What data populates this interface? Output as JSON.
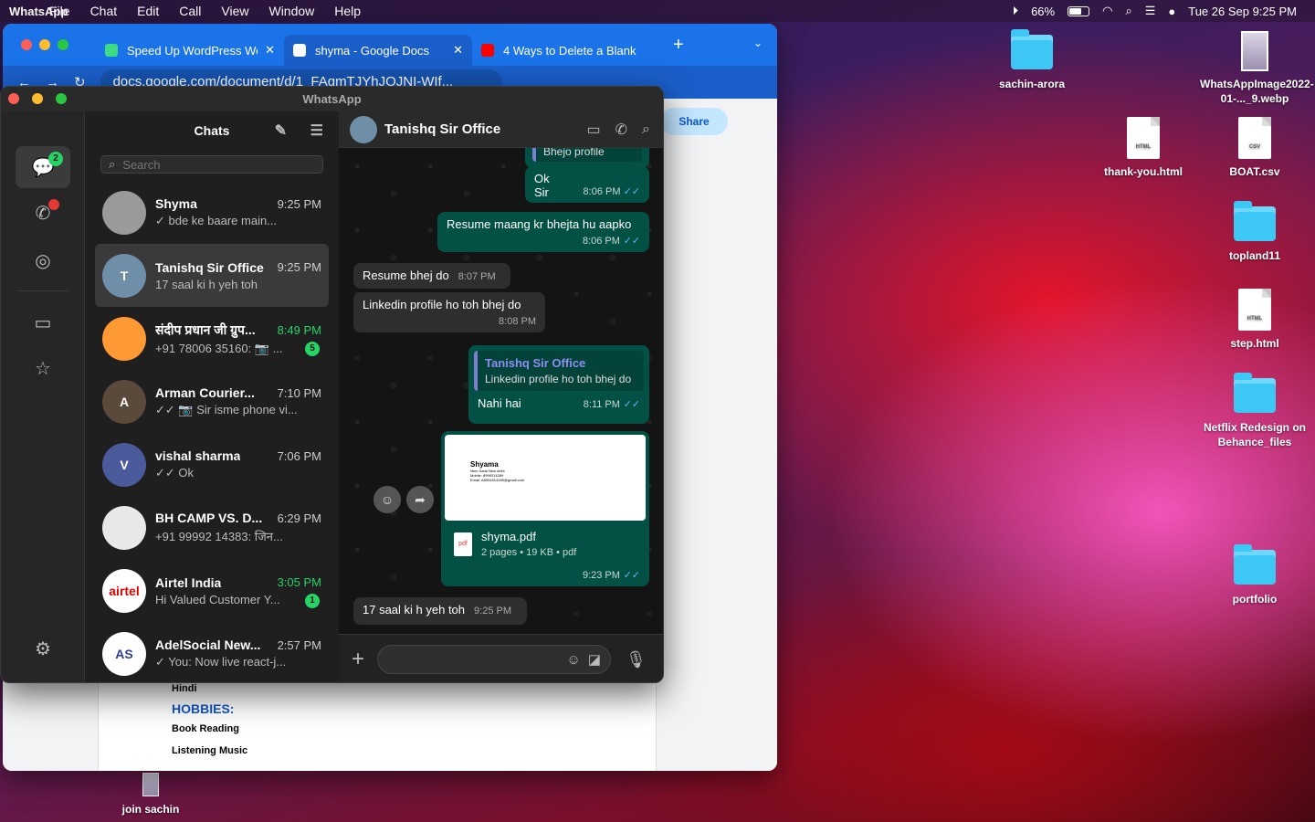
{
  "menubar": {
    "app": "WhatsApp",
    "items": [
      "File",
      "Chat",
      "Edit",
      "Call",
      "View",
      "Window",
      "Help"
    ],
    "battery": "66%",
    "battery_level": 0.66,
    "datetime": "Tue 26 Sep  9:25 PM"
  },
  "desktop": {
    "icons": [
      {
        "label": "sachin-arora",
        "type": "folder"
      },
      {
        "label": "WhatsAppImage2022-01-..._9.webp",
        "type": "image"
      },
      {
        "label": "thank-you.html",
        "type": "file",
        "badge": "HTML"
      },
      {
        "label": "BOAT.csv",
        "type": "file",
        "badge": "CSV"
      },
      {
        "label": "topland11",
        "type": "folder"
      },
      {
        "label": "step.html",
        "type": "file",
        "badge": "HTML"
      },
      {
        "label": "Netflix Redesign on Behance_files",
        "type": "folder"
      },
      {
        "label": "portfolio",
        "type": "folder"
      },
      {
        "label": "join sachin",
        "type": "image"
      }
    ]
  },
  "browser": {
    "tabs": [
      {
        "title": "Speed Up WordPress Web",
        "icon": "wordpress-icon"
      },
      {
        "title": "shyma - Google Docs",
        "icon": "docs-icon",
        "active": true
      },
      {
        "title": "4 Ways to Delete a Blank",
        "icon": "youtube-icon"
      }
    ],
    "url": "docs.google.com/document/d/1_FAqmTJYhJOJNI-WIf...",
    "share_label": "Share",
    "doc": {
      "line1": "Hindi",
      "heading": "HOBBIES:",
      "items": [
        "Book Reading",
        "Listening Music"
      ]
    }
  },
  "whatsapp": {
    "window_title": "WhatsApp",
    "rail": {
      "chats_badge": "2"
    },
    "list": {
      "title": "Chats",
      "search_placeholder": "Search",
      "chats": [
        {
          "name": "Shyma",
          "time": "9:25 PM",
          "preview": "✓ bde  ke baare main...",
          "avatar_color": "#9a9a9a",
          "initial": "",
          "unread": ""
        },
        {
          "name": "Tanishq Sir Office",
          "time": "9:25 PM",
          "preview": "17 saal ki h yeh toh",
          "avatar_color": "#6f8fa8",
          "initial": "T",
          "unread": "",
          "selected": true
        },
        {
          "name": "संदीप प्रधान जी ग्रुप...",
          "time": "8:49 PM",
          "preview": "+91 78006 35160: 📷 ...",
          "avatar_color": "#ff9933",
          "initial": "",
          "unread": "5",
          "time_green": true
        },
        {
          "name": "Arman Courier...",
          "time": "7:10 PM",
          "preview": "✓✓ 📷 Sir isme phone vi...",
          "avatar_color": "#5a4a3a",
          "initial": "A",
          "unread": ""
        },
        {
          "name": "vishal sharma",
          "time": "7:06 PM",
          "preview": "✓✓ Ok",
          "avatar_color": "#4b5a9a",
          "initial": "V",
          "unread": ""
        },
        {
          "name": "BH CAMP VS. D...",
          "time": "6:29 PM",
          "preview": "+91 99992 14383: जिन...",
          "avatar_color": "#e8e8e8",
          "initial": "",
          "unread": ""
        },
        {
          "name": "Airtel India",
          "time": "3:05 PM",
          "preview": "Hi  Valued Customer  Y...",
          "avatar_color": "#ffffff",
          "initial": "airtel",
          "unread": "1",
          "time_green": true
        },
        {
          "name": "AdelSocial New...",
          "time": "2:57 PM",
          "preview": "✓ You: Now live react-j...",
          "avatar_color": "#ffffff",
          "initial": "AS",
          "unread": ""
        }
      ]
    },
    "conversation": {
      "name": "Tanishq Sir Office",
      "messages": {
        "m0": {
          "text": "Bhejo profile"
        },
        "m1": {
          "text": "Ok\nSir",
          "time": "8:06 PM"
        },
        "m2": {
          "text": "Resume maang kr bhejta hu aapko",
          "time": "8:06 PM"
        },
        "m3": {
          "text": "Resume bhej do",
          "time": "8:07 PM"
        },
        "m4": {
          "text": "Linkedin profile ho toh bhej do",
          "time": "8:08 PM"
        },
        "m5": {
          "quote_name": "Tanishq Sir Office",
          "quote_text": "Linkedin profile ho toh bhej do",
          "text": "Nahi hai",
          "time": "8:11 PM"
        },
        "m6": {
          "preview_name": "Shyama",
          "preview_lines": [
            "Nem Sarai New delhi",
            "Mobile: 8999314289",
            "Email: A8994914289@gmail.com"
          ],
          "file_name": "shyma.pdf",
          "file_meta": "2 pages • 19 KB • pdf",
          "time": "9:23 PM"
        },
        "m7": {
          "text": "17 saal ki h yeh toh",
          "time": "9:25 PM"
        }
      },
      "composer_placeholder": ""
    }
  }
}
